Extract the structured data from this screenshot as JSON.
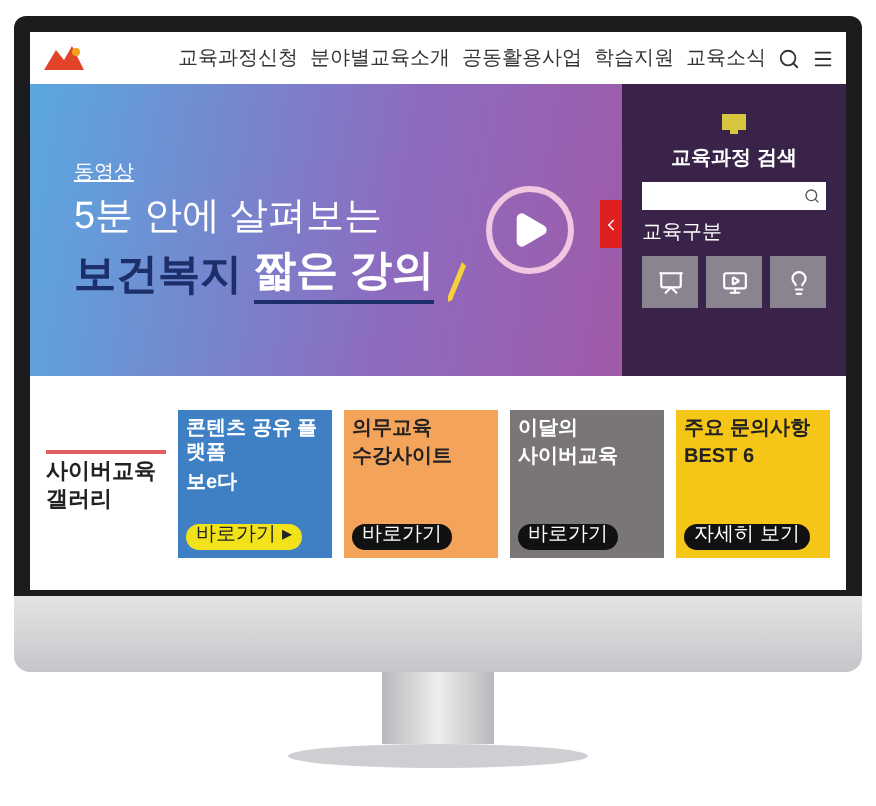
{
  "nav": {
    "items": [
      "교육과정신청",
      "분야별교육소개",
      "공동활용사업",
      "학습지원",
      "교육소식"
    ]
  },
  "hero": {
    "tag": "동영상",
    "line1": "5분 안에 살펴보는",
    "line2a": "보건복지",
    "line2b": "짧은 강의"
  },
  "search_panel": {
    "title": "교육과정 검색",
    "section": "교육구분"
  },
  "gallery": {
    "title": "사이버교육 갤러리",
    "cards": [
      {
        "kind": "blue",
        "title": "콘텐츠 공유 플랫폼",
        "subtitle": "보e다",
        "button": "바로가기 ▸"
      },
      {
        "kind": "orange",
        "title": "의무교육",
        "subtitle": "수강사이트",
        "button": "바로가기"
      },
      {
        "kind": "gray",
        "title": "이달의",
        "subtitle": "사이버교육",
        "button": "바로가기"
      },
      {
        "kind": "yellow",
        "title": "주요 문의사항",
        "subtitle": "BEST 6",
        "button": "자세히 보기"
      }
    ]
  }
}
